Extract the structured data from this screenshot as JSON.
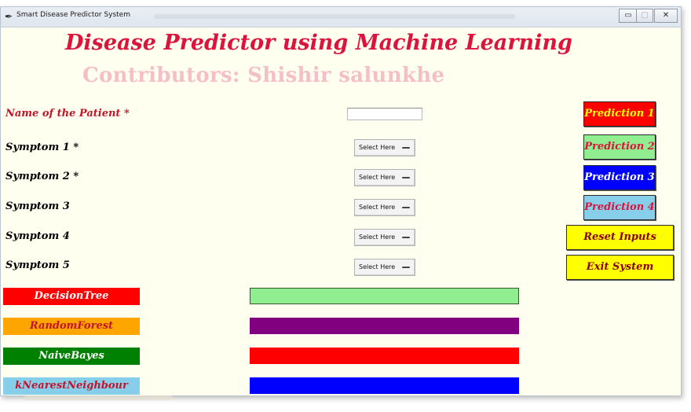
{
  "window": {
    "title": "Smart Disease Predictor System",
    "minimize_symbol": "▭",
    "maximize_symbol": "▢",
    "close_symbol": "✕"
  },
  "header": {
    "title": "Disease Predictor using Machine Learning",
    "contributors": "Contributors: Shishir salunkhe"
  },
  "form": {
    "name_label": "Name of the Patient *",
    "name_value": "",
    "symptoms": [
      {
        "label": "Symptom 1 *",
        "selected": "Select Here"
      },
      {
        "label": "Symptom 2 *",
        "selected": "Select Here"
      },
      {
        "label": "Symptom 3",
        "selected": "Select Here"
      },
      {
        "label": "Symptom 4",
        "selected": "Select Here"
      },
      {
        "label": "Symptom 5",
        "selected": "Select Here"
      }
    ]
  },
  "buttons": {
    "prediction_1": "Prediction 1",
    "prediction_2": "Prediction 2",
    "prediction_3": "Prediction 3",
    "prediction_4": "Prediction 4",
    "reset": "Reset Inputs",
    "exit": "Exit System"
  },
  "algorithms": [
    {
      "label": "DecisionTree",
      "result": "",
      "color": "#ff0000",
      "result_color": "#90ee90"
    },
    {
      "label": "RandomForest",
      "result": "",
      "color": "#ffa500",
      "result_color": "#800080"
    },
    {
      "label": "NaiveBayes",
      "result": "",
      "color": "#008000",
      "result_color": "#ff0000"
    },
    {
      "label": "kNearestNeighbour",
      "result": "",
      "color": "#87ceeb",
      "result_color": "#0000ff"
    }
  ],
  "colors": {
    "background": "#fffff0",
    "heading": "#dc143c",
    "contributors": "#f5bfc8"
  },
  "icons": {
    "app": "feather-icon"
  }
}
